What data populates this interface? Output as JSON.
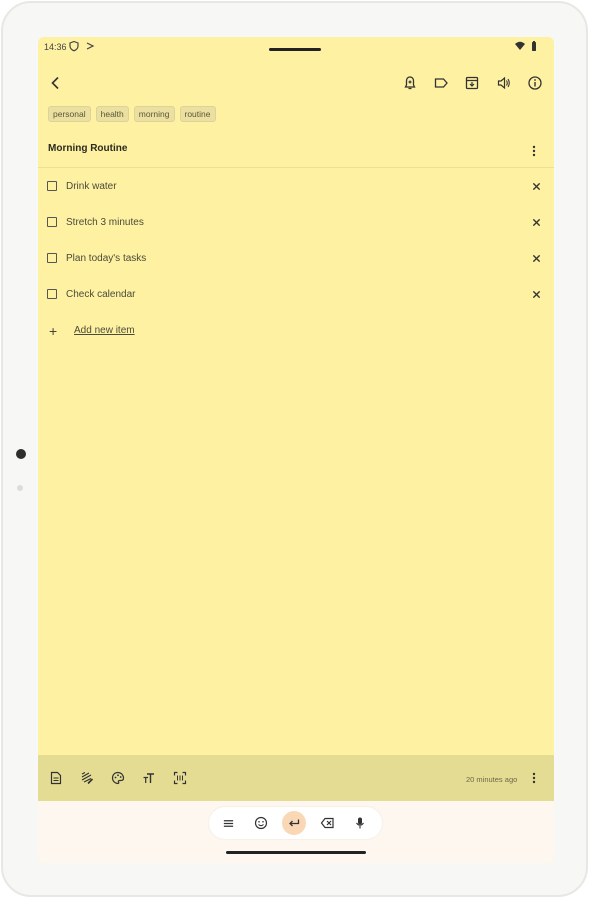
{
  "status": {
    "time": "14:36"
  },
  "toolbar": {
    "icons": [
      "back-icon",
      "reminder-icon",
      "label-icon",
      "archive-icon",
      "speaker-icon",
      "info-icon"
    ]
  },
  "tags": [
    "personal",
    "health",
    "morning",
    "routine"
  ],
  "note": {
    "title": "Morning Routine",
    "items": [
      {
        "text": "Drink water",
        "checked": false
      },
      {
        "text": "Stretch 3 minutes",
        "checked": false
      },
      {
        "text": "Plan today's tasks",
        "checked": false
      },
      {
        "text": "Check calendar",
        "checked": false
      }
    ],
    "add_item_label": "Add new item"
  },
  "bottom": {
    "edited": "20 minutes ago",
    "icons": [
      "note-type-icon",
      "draw-icon",
      "palette-icon",
      "text-format-icon",
      "scan-icon"
    ]
  },
  "nav": {
    "buttons": [
      "menu-icon",
      "emoji-icon",
      "enter-icon",
      "backspace-icon",
      "mic-icon"
    ]
  },
  "colors": {
    "note_bg": "#fef1a2",
    "bottom_bar": "#e5dc93",
    "nav_active": "#fbd8b5"
  }
}
